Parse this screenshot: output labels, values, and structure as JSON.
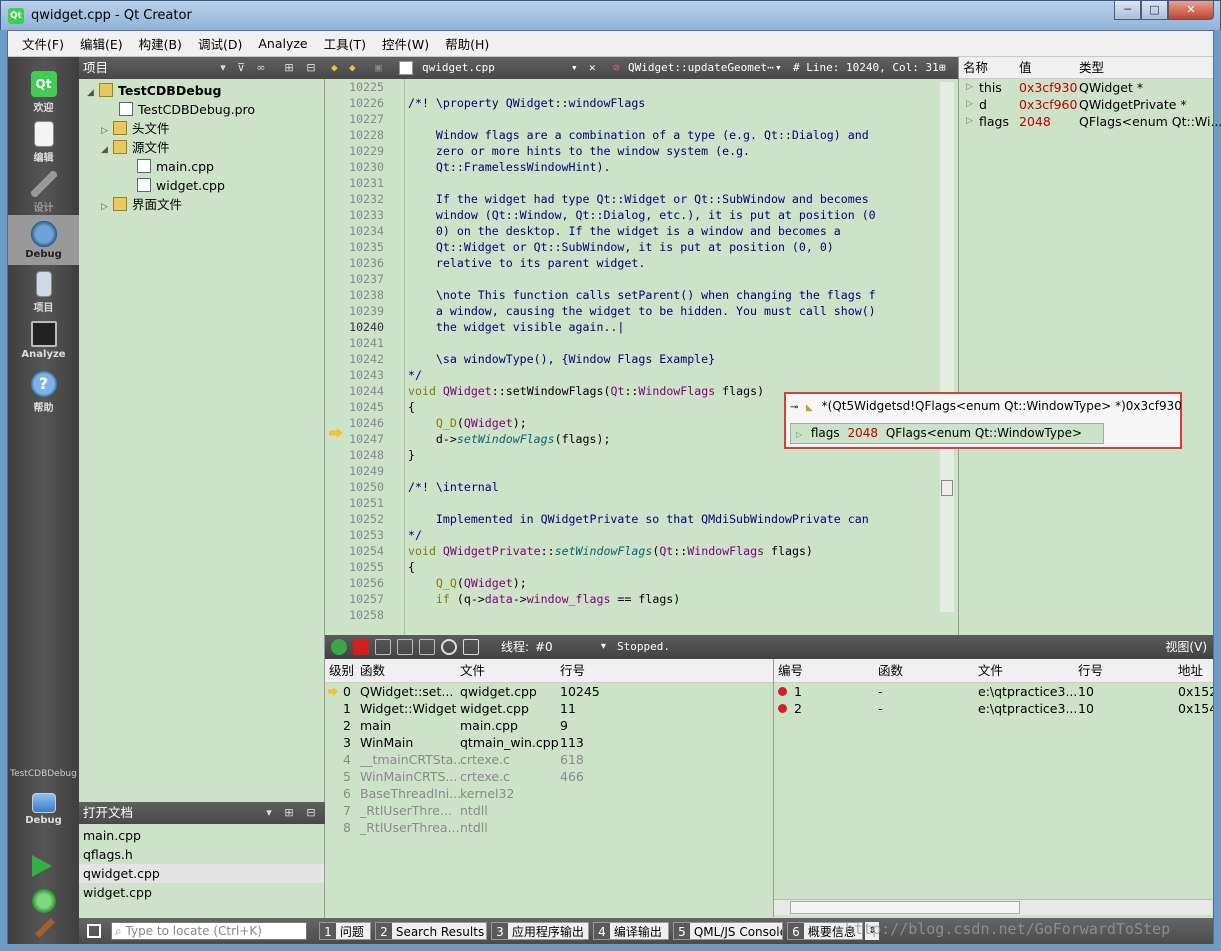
{
  "window": {
    "title": "qwidget.cpp - Qt Creator",
    "min": "─",
    "max": "□",
    "close": "✕"
  },
  "menu": [
    "文件(F)",
    "编辑(E)",
    "构建(B)",
    "调试(D)",
    "Analyze",
    "工具(T)",
    "控件(W)",
    "帮助(H)"
  ],
  "modes": [
    {
      "label": "欢迎"
    },
    {
      "label": "编辑"
    },
    {
      "label": "设计"
    },
    {
      "label": "Debug"
    },
    {
      "label": "项目"
    },
    {
      "label": "Analyze"
    },
    {
      "label": "帮助"
    }
  ],
  "kit": {
    "project": "TestCDBDebug",
    "mode": "Debug"
  },
  "projects": {
    "header": "项目",
    "tree": [
      {
        "label": "TestCDBDebug",
        "bold": true
      },
      {
        "label": "TestCDBDebug.pro"
      },
      {
        "label": "头文件"
      },
      {
        "label": "源文件"
      },
      {
        "label": "main.cpp"
      },
      {
        "label": "widget.cpp"
      },
      {
        "label": "界面文件"
      }
    ]
  },
  "open_docs": {
    "header": "打开文档",
    "items": [
      "main.cpp",
      "qflags.h",
      "qwidget.cpp",
      "widget.cpp"
    ],
    "selected": 2
  },
  "editor": {
    "file": "qwidget.cpp",
    "symbol": "QWidget::updateGeomet⋯",
    "position": "# Line: 10240, Col: 31",
    "first_line": 10225,
    "current_line": 10240,
    "breakpoint_line": 10245
  },
  "locals": {
    "columns": [
      "名称",
      "值",
      "类型"
    ],
    "rows": [
      {
        "name": "this",
        "value": "0x3cf930",
        "type": "QWidget *"
      },
      {
        "name": "d",
        "value": "0x3cf960",
        "type": "QWidgetPrivate *"
      },
      {
        "name": "flags",
        "value": "2048",
        "type": "QFlags<enum Qt::Wi..."
      }
    ]
  },
  "tooltip": {
    "title": "*(Qt5Widgetsd!QFlags<enum Qt::WindowType> *)0x3cf930",
    "row": {
      "name": "flags",
      "value": "2048",
      "type": "QFlags<enum Qt::WindowType>"
    }
  },
  "debugbar": {
    "thread_label": "线程:",
    "thread_value": "#0",
    "status": "Stopped.",
    "view_label": "视图(V)"
  },
  "stack": {
    "columns": [
      "级别",
      "函数",
      "文件",
      "行号"
    ],
    "rows": [
      {
        "level": "0",
        "func": "QWidget::set...",
        "file": "qwidget.cpp",
        "line": "10245",
        "gray": false,
        "current": true
      },
      {
        "level": "1",
        "func": "Widget::Widget",
        "file": "widget.cpp",
        "line": "11",
        "gray": false
      },
      {
        "level": "2",
        "func": "main",
        "file": "main.cpp",
        "line": "9",
        "gray": false
      },
      {
        "level": "3",
        "func": "WinMain",
        "file": "qtmain_win.cpp",
        "line": "113",
        "gray": false
      },
      {
        "level": "4",
        "func": "__tmainCRTSta...",
        "file": "crtexe.c",
        "line": "618",
        "gray": true
      },
      {
        "level": "5",
        "func": "WinMainCRTS...",
        "file": "crtexe.c",
        "line": "466",
        "gray": true
      },
      {
        "level": "6",
        "func": "BaseThreadIni...",
        "file": "kernel32",
        "line": "",
        "gray": true
      },
      {
        "level": "7",
        "func": "_RtlUserThre...",
        "file": "ntdll",
        "line": "",
        "gray": true
      },
      {
        "level": "8",
        "func": "_RtlUserThrea...",
        "file": "ntdll",
        "line": "",
        "gray": true
      }
    ]
  },
  "breakpoints": {
    "columns": [
      "编号",
      "函数",
      "文件",
      "行号",
      "地址"
    ],
    "rows": [
      {
        "num": "1",
        "func": "-",
        "file": "e:\\qtpractice3...",
        "line": "10",
        "addr": "0x152"
      },
      {
        "num": "2",
        "func": "-",
        "file": "e:\\qtpractice3...",
        "line": "10",
        "addr": "0x154"
      }
    ]
  },
  "statusbar": {
    "locate_placeholder": "Type to locate (Ctrl+K)",
    "tabs": [
      {
        "n": "1",
        "label": "问题"
      },
      {
        "n": "2",
        "label": "Search Results"
      },
      {
        "n": "3",
        "label": "应用程序输出"
      },
      {
        "n": "4",
        "label": "编译输出"
      },
      {
        "n": "5",
        "label": "QML/JS Console"
      },
      {
        "n": "6",
        "label": "概要信息"
      }
    ]
  },
  "watermark": "http://blog.csdn.net/GoForwardToStep",
  "colors": {
    "pane_bg": "#cde3c7",
    "comment": "#000080",
    "keyword": "#808000",
    "type": "#800080",
    "value_red": "#c00000",
    "highlight_border": "#e03b35"
  }
}
